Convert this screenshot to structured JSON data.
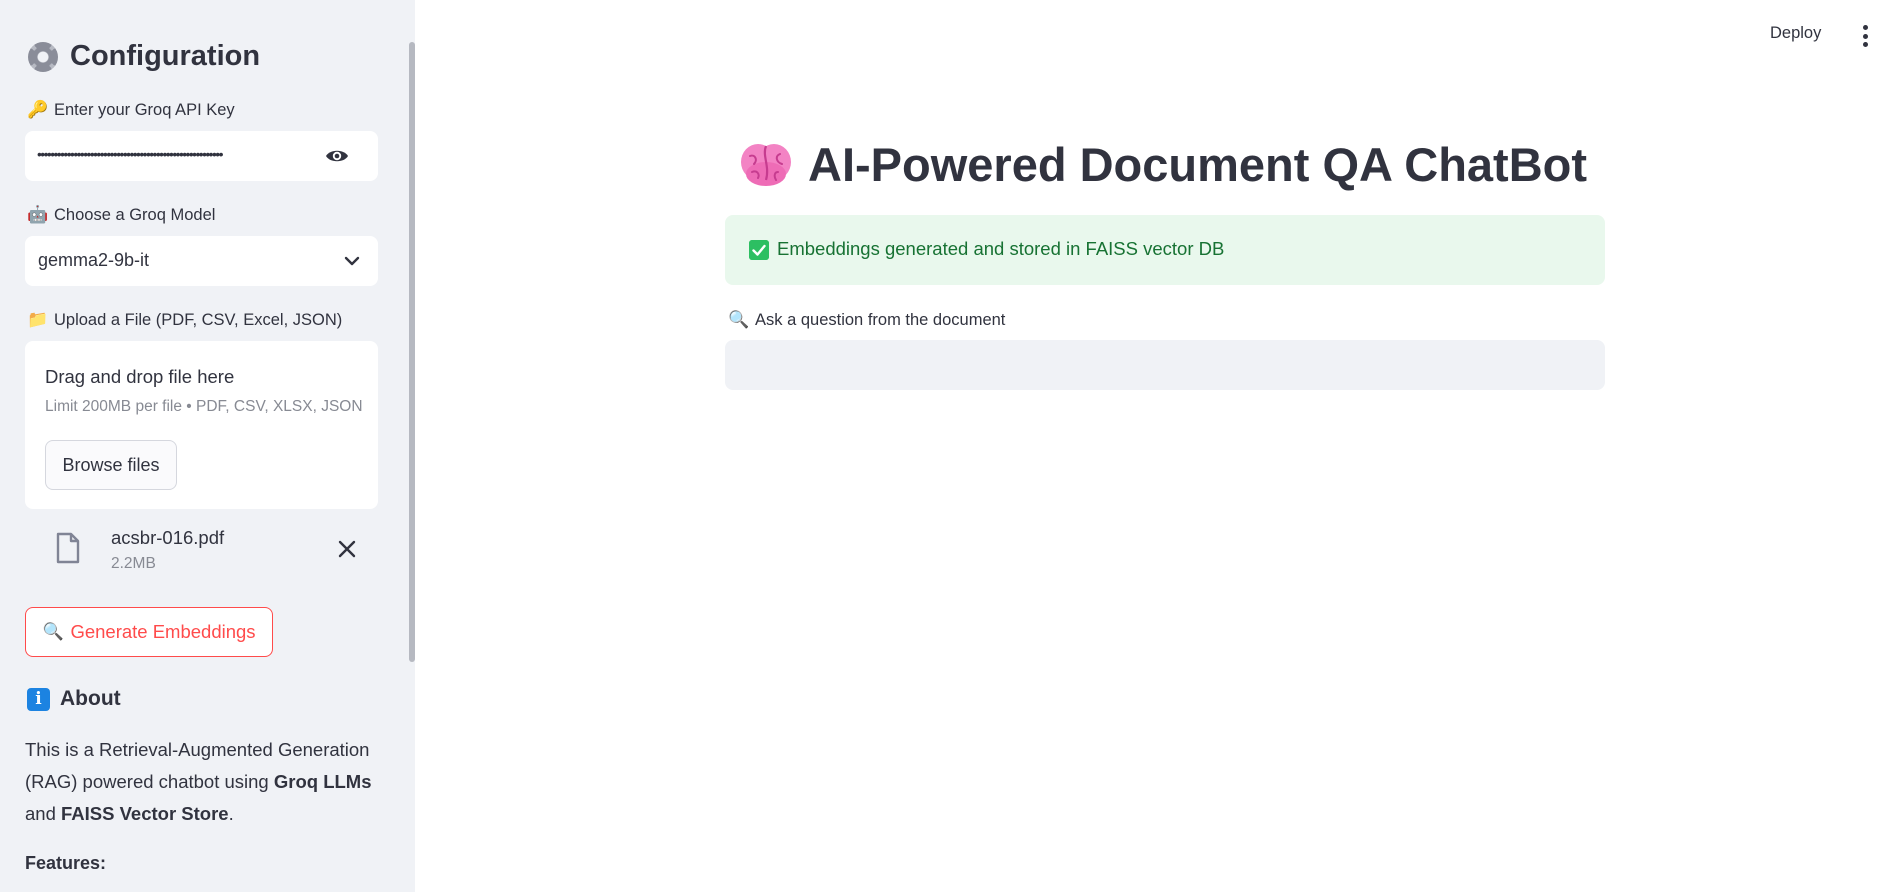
{
  "sidebar": {
    "title": "Configuration",
    "api_key": {
      "label": "Enter your Groq API Key",
      "value": "••••••••••••••••••••••••••••••••••••••••••••••••••••••••"
    },
    "model": {
      "label": "Choose a Groq Model",
      "selected": "gemma2-9b-it"
    },
    "upload": {
      "label": "Upload a File (PDF, CSV, Excel, JSON)",
      "drop_title": "Drag and drop file here",
      "drop_limit": "Limit 200MB per file • PDF, CSV, XLSX, JSON",
      "browse_label": "Browse files",
      "file": {
        "name": "acsbr-016.pdf",
        "size": "2.2MB"
      }
    },
    "generate_label": "Generate Embeddings",
    "about": {
      "heading": "About",
      "p1": "This is a Retrieval-Augmented Generation (RAG) powered chatbot using ",
      "groq": "Groq LLMs",
      "and": " and ",
      "faiss": "FAISS Vector Store",
      "end": ".",
      "features": "Features:"
    }
  },
  "header": {
    "deploy_label": "Deploy"
  },
  "main": {
    "title": "AI-Powered Document QA ChatBot",
    "success_message": "Embeddings generated and stored in FAISS vector DB",
    "question_label": "Ask a question from the document",
    "question_value": ""
  },
  "colors": {
    "primary": "#ff4b4b",
    "sidebar_bg": "#f0f2f6",
    "success_bg": "#e9f8ed",
    "success_text": "#177233",
    "info_blue": "#1c83e1"
  }
}
